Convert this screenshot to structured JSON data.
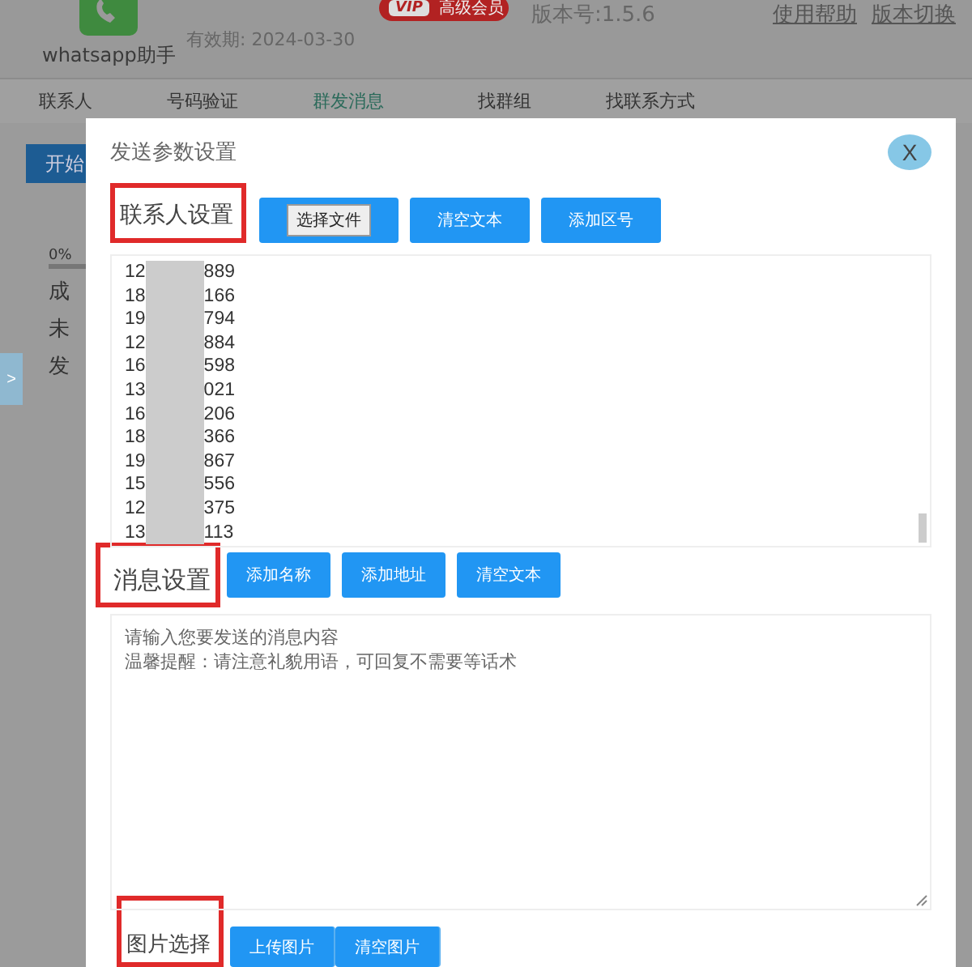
{
  "header": {
    "app_name": "whatsapp助手",
    "validity": "有效期: 2024-03-30",
    "vip_badge": {
      "tag": "VIP",
      "label": "高级会员"
    },
    "version": "版本号:1.5.6",
    "links": [
      "使用帮助",
      "版本切换"
    ]
  },
  "tabs": [
    {
      "label": "联系人",
      "selected": false
    },
    {
      "label": "号码验证",
      "selected": false
    },
    {
      "label": "群发消息",
      "selected": true
    },
    {
      "label": "找群组",
      "selected": false
    },
    {
      "label": "找联系方式",
      "selected": false
    }
  ],
  "background_panel": {
    "start_button": "开始",
    "progress": {
      "reading": "0%"
    },
    "lines": [
      "成",
      "未",
      "发"
    ],
    "side_toggle": ">"
  },
  "dialog": {
    "title": "发送参数设置",
    "close": "X",
    "sections": [
      {
        "label": "联系人设置",
        "buttons": [
          {
            "label": "选择文件",
            "kind": "file"
          },
          {
            "label": "清空文本",
            "kind": "action"
          },
          {
            "label": "添加区号",
            "kind": "action"
          }
        ],
        "numbers": [
          {
            "prefix": "12",
            "suffix": "889"
          },
          {
            "prefix": "18",
            "suffix": "166"
          },
          {
            "prefix": "19",
            "suffix": "794"
          },
          {
            "prefix": "12",
            "suffix": "884"
          },
          {
            "prefix": "16",
            "suffix": "598"
          },
          {
            "prefix": "13",
            "suffix": "021"
          },
          {
            "prefix": "16",
            "suffix": "206"
          },
          {
            "prefix": "18",
            "suffix": "366"
          },
          {
            "prefix": "19",
            "suffix": "867"
          },
          {
            "prefix": "15",
            "suffix": "556"
          },
          {
            "prefix": "12",
            "suffix": "375"
          },
          {
            "prefix": "13",
            "suffix": "113"
          }
        ]
      },
      {
        "label": "消息设置",
        "buttons": [
          {
            "label": "添加名称",
            "kind": "action"
          },
          {
            "label": "添加地址",
            "kind": "action"
          },
          {
            "label": "清空文本",
            "kind": "action"
          }
        ],
        "placeholder_lines": [
          "请输入您要发送的消息内容",
          "温馨提醒：请注意礼貌用语，可回复不需要等话术"
        ]
      },
      {
        "label": "图片选择",
        "buttons": [
          {
            "label": "上传图片",
            "kind": "action"
          },
          {
            "label": "清空图片",
            "kind": "action"
          }
        ]
      }
    ]
  }
}
